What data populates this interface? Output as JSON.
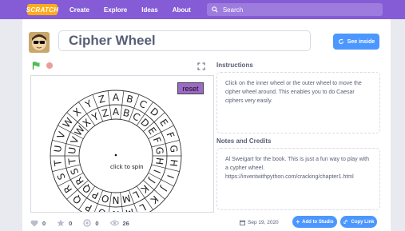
{
  "nav": {
    "logo": "SCRATCH",
    "links": [
      "Create",
      "Explore",
      "Ideas",
      "About"
    ],
    "search_placeholder": "Search"
  },
  "project": {
    "title": "Cipher Wheel",
    "see_inside_label": "See inside"
  },
  "stage": {
    "reset_label": "reset",
    "spin_label": "click to spin",
    "outer_letters": [
      "A",
      "B",
      "C",
      "D",
      "E",
      "F",
      "G",
      "H",
      "I",
      "J",
      "K",
      "L",
      "M",
      "N",
      "O",
      "P",
      "Q",
      "R",
      "S",
      "T",
      "U",
      "V",
      "W",
      "X",
      "Y",
      "Z"
    ],
    "inner_letters": [
      "A",
      "B",
      "C",
      "D",
      "E",
      "F",
      "G",
      "H",
      "I",
      "J",
      "K",
      "L",
      "M",
      "N",
      "O",
      "P",
      "Q",
      "R",
      "S",
      "T",
      "U",
      "V",
      "W",
      "X",
      "Y",
      "Z"
    ]
  },
  "instructions": {
    "title": "Instructions",
    "text": "Click on the inner wheel or the outer wheel to move the cipher wheel around. This enables you to do Caesar ciphers very easily."
  },
  "notes": {
    "title": "Notes and Credits",
    "line1": "Al Sweigart for the book. This is just a fun way to play with  a cypher wheel.",
    "line2": "https://inventwithpython.com/cracking/chapter1.html"
  },
  "stats": {
    "loves": "0",
    "favorites": "0",
    "remixes": "0",
    "views": "26"
  },
  "date": "Sep 19, 2020",
  "actions": {
    "add_to_studio": "Add to Studio",
    "copy_link": "Copy Link"
  },
  "colors": {
    "nav": "#855cd6",
    "accent_blue": "#4c97ff",
    "reset_purple": "#9b69c6",
    "text": "#575e75"
  }
}
